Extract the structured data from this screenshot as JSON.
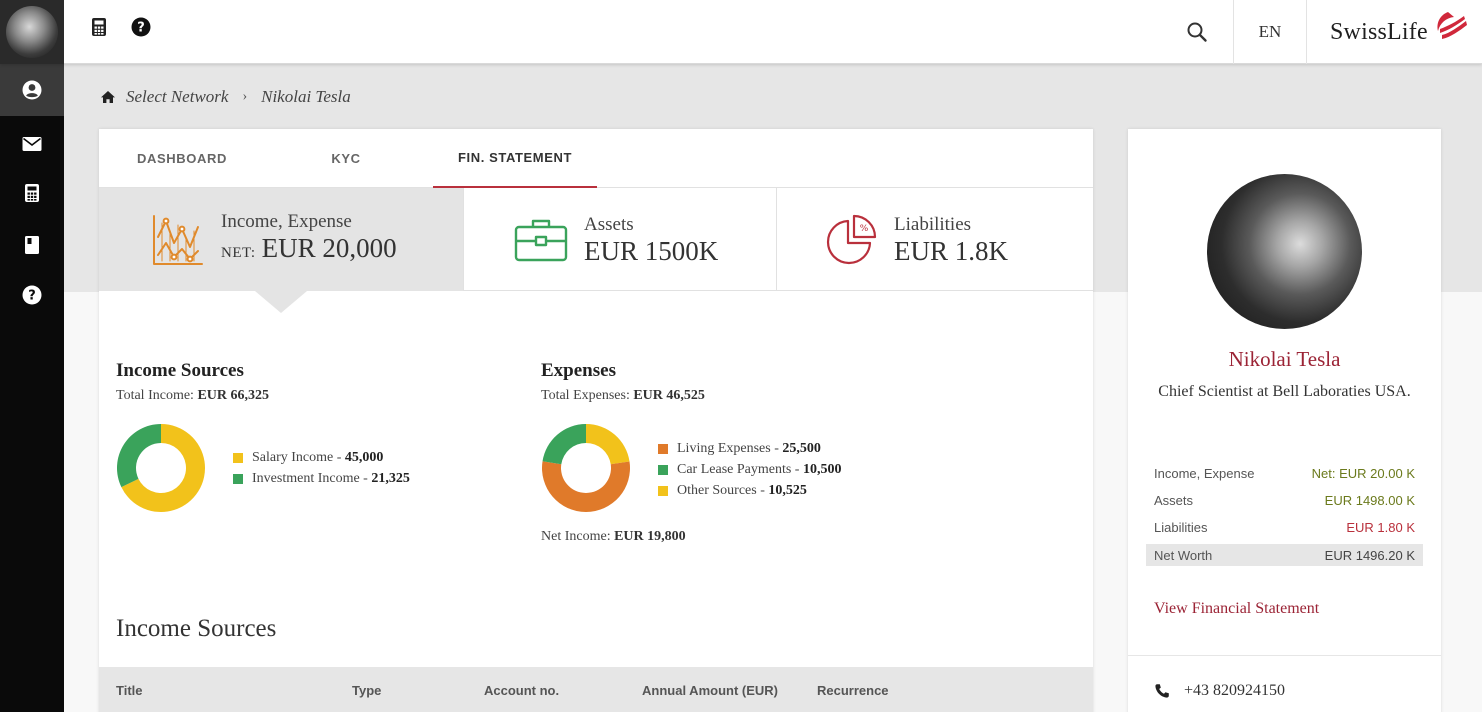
{
  "topbar": {
    "language": "EN",
    "logo_text": "SwissLife"
  },
  "breadcrumb": {
    "home": "Select Network",
    "current": "Nikolai Tesla"
  },
  "tabs": [
    {
      "label": "DASHBOARD",
      "active": false
    },
    {
      "label": "KYC",
      "active": false
    },
    {
      "label": "FIN. STATEMENT",
      "active": true
    }
  ],
  "summary": {
    "income_expense": {
      "label": "Income, Expense",
      "prefix": "NET:",
      "value": "EUR 20,000",
      "color": "#e08a2c"
    },
    "assets": {
      "label": "Assets",
      "value": "EUR 1500K",
      "color": "#3aa35b"
    },
    "liabilities": {
      "label": "Liabilities",
      "value": "EUR 1.8K",
      "color": "#b9303c"
    }
  },
  "income_sources": {
    "title": "Income Sources",
    "total_label": "Total Income:",
    "total_value": "EUR 66,325",
    "legend": [
      {
        "label": "Salary Income - ",
        "value": "45,000",
        "amount": 45000,
        "color": "#f2c21b"
      },
      {
        "label": "Investment Income - ",
        "value": "21,325",
        "amount": 21325,
        "color": "#3aa35b"
      }
    ]
  },
  "expenses": {
    "title": "Expenses",
    "total_label": "Total Expenses:",
    "total_value": "EUR 46,525",
    "legend": [
      {
        "label": "Living Expenses - ",
        "value": "25,500",
        "amount": 25500,
        "color": "#e07a2a"
      },
      {
        "label": "Car Lease Payments - ",
        "value": "10,500",
        "amount": 10500,
        "color": "#3aa35b"
      },
      {
        "label": "Other Sources - ",
        "value": "10,525",
        "amount": 10525,
        "color": "#f2c21b"
      }
    ],
    "net_label": "Net Income:",
    "net_value": "EUR 19,800"
  },
  "table": {
    "heading": "Income Sources",
    "columns": [
      "Title",
      "Type",
      "Account no.",
      "Annual Amount (EUR)",
      "Recurrence"
    ]
  },
  "profile": {
    "name": "Nikolai Tesla",
    "role": "Chief Scientist at Bell Laboraties USA.",
    "stats": [
      {
        "label": "Income, Expense",
        "value": "Net: EUR 20.00 K",
        "color": "#6b7a1c"
      },
      {
        "label": "Assets",
        "value": "EUR 1498.00 K",
        "color": "#6b7a1c"
      },
      {
        "label": "Liabilities",
        "value": "EUR 1.80 K",
        "color": "#b9303c"
      },
      {
        "label": "Net Worth",
        "value": "EUR 1496.20 K",
        "color": "#444444"
      }
    ],
    "view_link": "View Financial Statement",
    "phone": "+43 820924150"
  }
}
